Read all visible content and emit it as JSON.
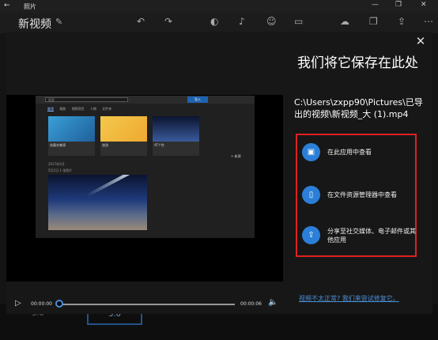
{
  "window": {
    "back_glyph": "←",
    "app_title": "照片",
    "controls": [
      "—",
      "❐",
      "✕"
    ]
  },
  "toolbar": {
    "project_name": "新视频",
    "icons": [
      "edit-icon",
      "undo-icon",
      "redo-icon",
      "theme-icon",
      "music-icon",
      "voice-icon",
      "aspect-ratio-icon",
      "upload-icon",
      "duplicate-icon",
      "share-icon",
      "more-icon"
    ]
  },
  "background": {
    "version_a": "3.0",
    "version_b": "3.0"
  },
  "dialog": {
    "close_glyph": "✕",
    "headline": "我们将它保存在此处",
    "save_path": "C:\\Users\\zxpp90\\Pictures\\已导出的视频\\新视频_大 (1).mp4",
    "options": [
      {
        "icon": "image-icon",
        "glyph": "▣",
        "label": "在此应用中查看"
      },
      {
        "icon": "file-explorer-icon",
        "glyph": "▯",
        "label": "在文件资源管理器中查看"
      },
      {
        "icon": "share-icon",
        "glyph": "⇪",
        "label": "分享至社交媒体、电子邮件或其他应用"
      }
    ],
    "footer_link": "视频不太正常? 我们来尝试修复它。",
    "accent_color": "#2b7fd8",
    "highlight_color": "#e02020"
  },
  "video": {
    "play_glyph": "▷",
    "time_current": "00:00:00",
    "time_total": "00:00:06",
    "progress": 0.0,
    "volume_glyph": "🔈",
    "frame": {
      "search_placeholder": "搜索",
      "blue_button": "导入",
      "tabs": [
        "集锦",
        "相册",
        "视频项目",
        "人物",
        "文件夹"
      ],
      "card_captions": [
        "收藏夹集锦",
        "旅游",
        "AT个性"
      ],
      "date_line1": "2017年5月",
      "date_line2": "5月2日 1 张照片",
      "new_label": "+ 新建"
    }
  }
}
